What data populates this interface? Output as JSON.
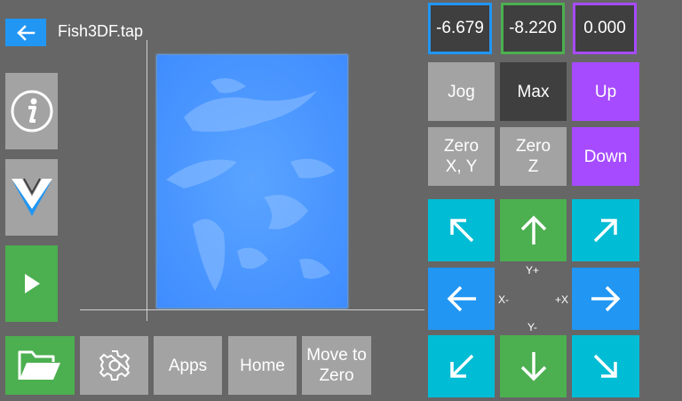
{
  "header": {
    "file_name": "Fish3DF.tap"
  },
  "colors": {
    "background": "#666666",
    "accent_blue": "#2196f3",
    "green": "#4caf50",
    "cyan": "#00bcd4",
    "purple": "#a64bff",
    "dark": "#3f3f3f",
    "gray": "#a3a3a3",
    "x_outline": "#2196f3",
    "y_outline": "#4caf50",
    "z_outline": "#a64bff"
  },
  "coordinates": {
    "x": "-6.679",
    "y": "-8.220",
    "z": "0.000"
  },
  "controls": {
    "jog": "Jog",
    "max": "Max",
    "up": "Up",
    "zero_xy": "Zero\nX, Y",
    "zero_z": "Zero\nZ",
    "down": "Down"
  },
  "jog_labels": {
    "y_plus": "Y+",
    "y_minus": "Y-",
    "x_minus": "X-",
    "x_plus": "+X"
  },
  "bottom_bar": {
    "apps": "Apps",
    "home": "Home",
    "move_to_zero": "Move to\nZero"
  },
  "icons": {
    "back": "arrow-left-icon",
    "info": "info-icon",
    "logo": "v-logo-icon",
    "play": "play-icon",
    "folder": "folder-open-icon",
    "settings": "gear-icon"
  }
}
